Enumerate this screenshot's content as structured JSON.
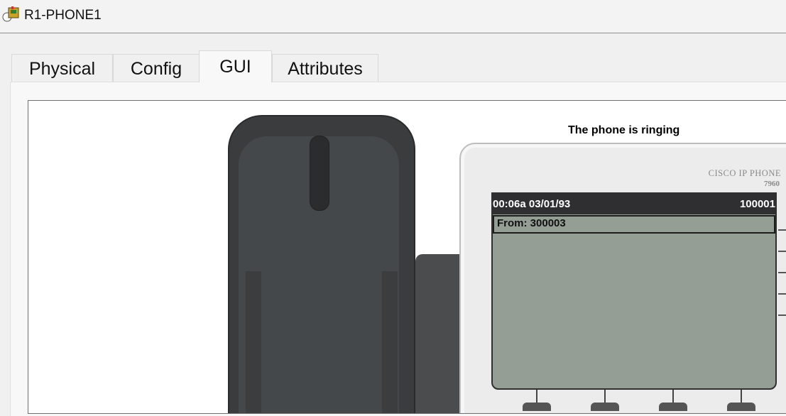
{
  "window": {
    "title": "R1-PHONE1"
  },
  "tabs": [
    {
      "label": "Physical"
    },
    {
      "label": "Config"
    },
    {
      "label": "GUI"
    },
    {
      "label": "Attributes"
    }
  ],
  "active_tab": "GUI",
  "gui": {
    "ring_status": "The phone is ringing",
    "brand": "CISCO IP PHONE",
    "model": "7960",
    "screen": {
      "datetime": "00:06a 03/01/93",
      "line_number": "100001",
      "caller_text": "From: 300003"
    }
  },
  "colors": {
    "screen_bg": "#959e94",
    "status_bar_bg": "#2f2f31",
    "handset": "#3a3c3e"
  }
}
